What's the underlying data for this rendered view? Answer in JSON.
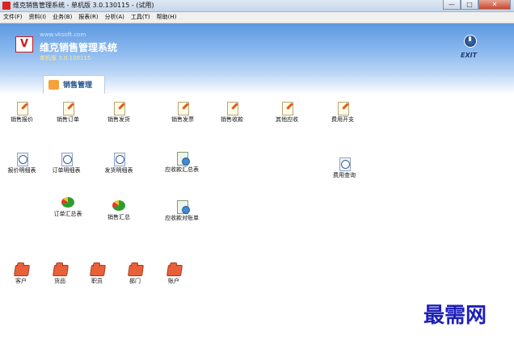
{
  "window": {
    "title": "维克销售管理系统 - 单机版 3.0.130115 - (试用)",
    "buttons": {
      "minimize": "—",
      "maximize": "□",
      "close": "✕"
    }
  },
  "menu": [
    "文件(F)",
    "资料(I)",
    "业务(B)",
    "报表(R)",
    "分析(A)",
    "工具(T)",
    "帮助(H)"
  ],
  "header": {
    "logo_mark": "V",
    "url": "www.vksoft.com",
    "name": "维克销售管理系统",
    "version": "单机版 3.0.130115",
    "exit": "EXIT"
  },
  "tab": {
    "label": "销售管理",
    "icon": "sales-management-icon"
  },
  "modules": {
    "row1": [
      "销售报价",
      "销售订单",
      "销售发货",
      "销售发票",
      "销售收款",
      "其他应收",
      "费用开支"
    ],
    "row2": [
      "报价明细表",
      "订单明细表",
      "发货明细表",
      "应收款汇总表",
      "费用查询"
    ],
    "row3": [
      "订单汇总表",
      "销售汇总",
      "应收款对账单"
    ],
    "row4": [
      "客户",
      "货品",
      "职员",
      "部门",
      "账户"
    ]
  },
  "watermark": "最需网",
  "colors": {
    "header_top": "#5d98e0",
    "folder": "#e8603a",
    "watermark": "#1d1fb8"
  }
}
